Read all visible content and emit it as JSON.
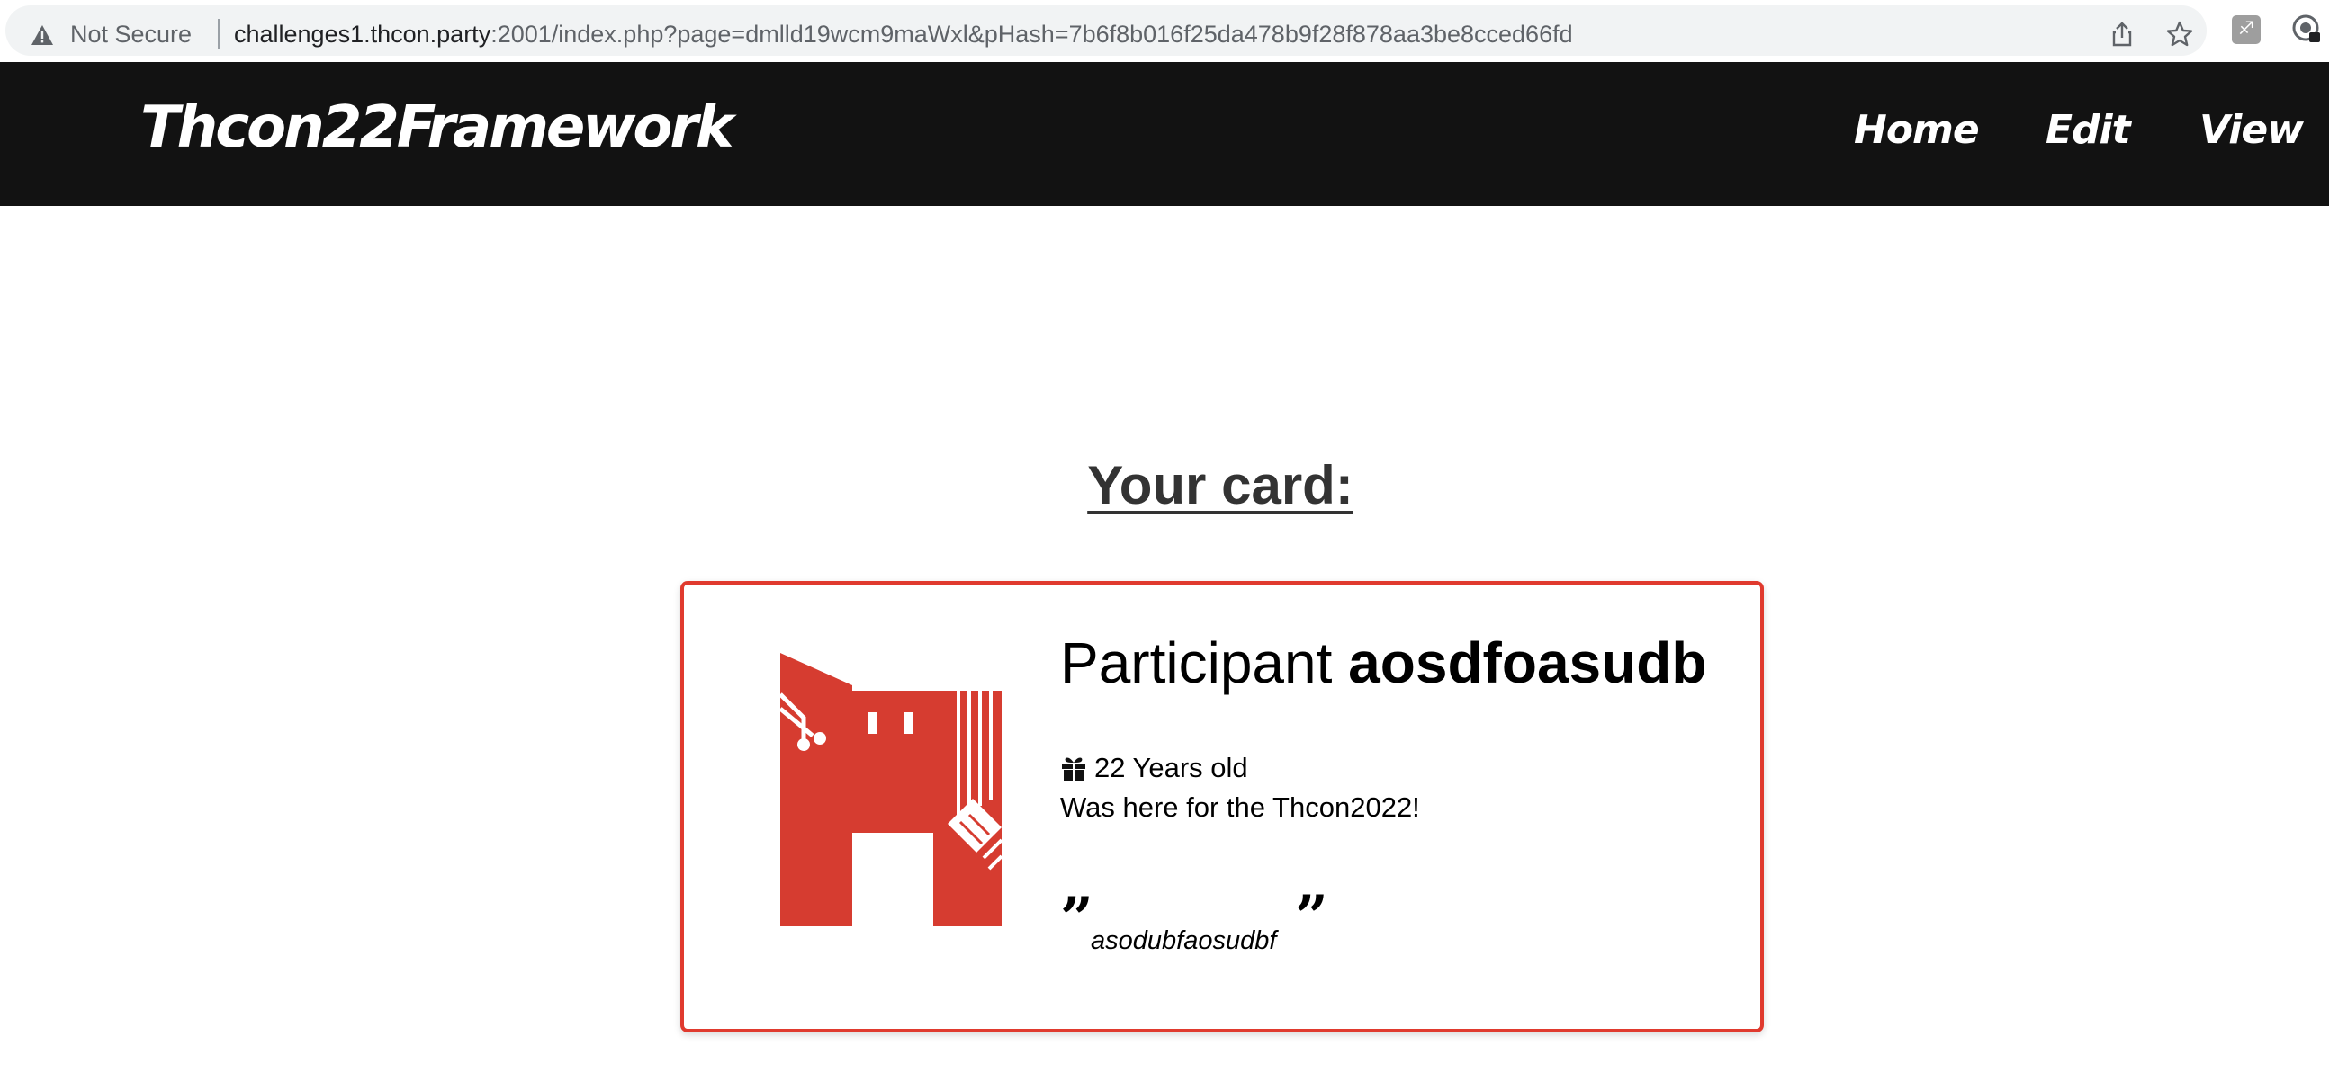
{
  "browser": {
    "security_label": "Not Secure",
    "url_host": "challenges1.thcon.party",
    "url_rest": ":2001/index.php?page=dmlld19wcm9maWxl&pHash=7b6f8b016f25da478b9f28f878aa3be8cced66fd",
    "icons": [
      "warning-icon",
      "share-icon",
      "bookmark-star-icon",
      "extension-icon",
      "profile-icon"
    ]
  },
  "navbar": {
    "brand": "Thcon22Framework",
    "links": [
      {
        "label": "Home"
      },
      {
        "label": "Edit"
      },
      {
        "label": "View"
      }
    ]
  },
  "main": {
    "heading": "Your card:"
  },
  "card": {
    "participant_prefix": "Participant",
    "participant_name": "aosdfoasudb",
    "age_text": "22 Years old",
    "presence_text": "Was here for the Thcon2022!",
    "quote": "asodubfaosudbf",
    "accent_color": "#e03a2e",
    "logo_color": "#d63c30"
  }
}
